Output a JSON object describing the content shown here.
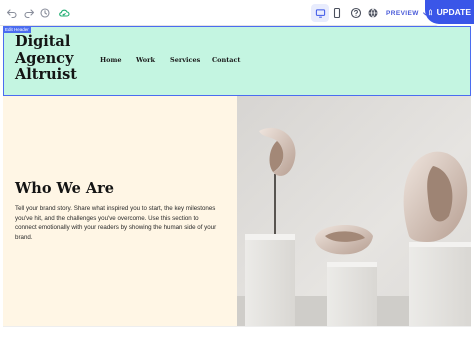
{
  "editor": {
    "edit_badge": "Edit Header",
    "preview_label": "PREVIEW",
    "update_label": "UPDATE",
    "accent": "#3a56e8"
  },
  "site": {
    "logo": "Digital Agency Altruist",
    "nav": [
      "Home",
      "Work",
      "Services",
      "Contact"
    ],
    "header_bg": "#c4f5e1",
    "section_bg": "#fff6e5"
  },
  "section": {
    "heading": "Who We Are",
    "body": "Tell your brand story. Share what inspired you to start, the key milestones you've hit, and the challenges you've overcome. Use this section to connect emotionally with your readers by showing the human side of your brand."
  }
}
